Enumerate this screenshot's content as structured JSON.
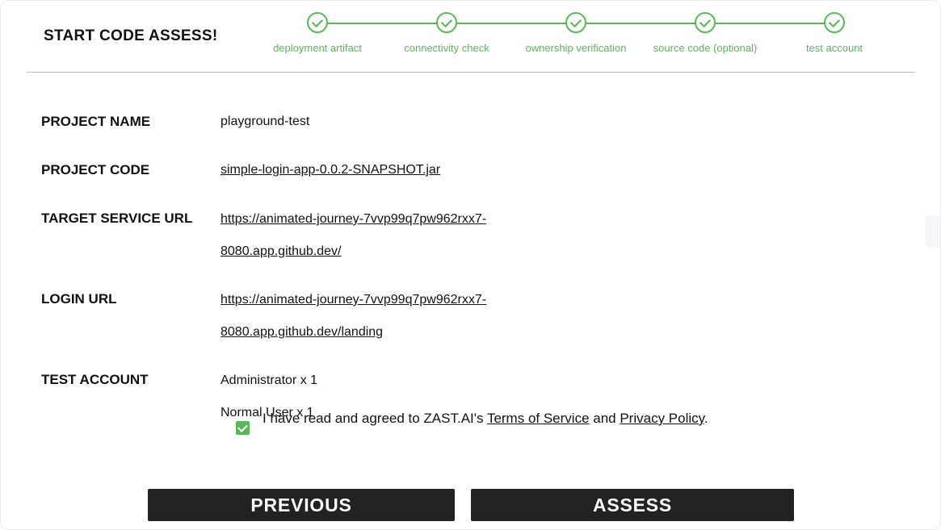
{
  "header": {
    "title": "START CODE ASSESS!"
  },
  "stepper": {
    "color": "#5bb65a",
    "steps": [
      {
        "label": "deployment artifact",
        "completed": true
      },
      {
        "label": "connectivity check",
        "completed": true
      },
      {
        "label": "ownership verification",
        "completed": true
      },
      {
        "label": "source code (optional)",
        "completed": true
      },
      {
        "label": "test account",
        "completed": true
      }
    ]
  },
  "details": {
    "project_name": {
      "label": "PROJECT NAME",
      "value": "playground-test"
    },
    "project_code": {
      "label": "PROJECT CODE",
      "value": "simple-login-app-0.0.2-SNAPSHOT.jar"
    },
    "target_service_url": {
      "label": "TARGET SERVICE URL",
      "value_line1": "https://animated-journey-7vvp99q7pw962rxx7-",
      "value_line2": "8080.app.github.dev/"
    },
    "login_url": {
      "label": "LOGIN URL",
      "value_line1": "https://animated-journey-7vvp99q7pw962rxx7-",
      "value_line2": "8080.app.github.dev/landing"
    },
    "test_account": {
      "label": "TEST ACCOUNT",
      "accounts": [
        "Administrator x 1",
        "Normal User x 1"
      ]
    }
  },
  "agreement": {
    "checked": true,
    "prefix": "I have read and agreed to ZAST.AI's ",
    "terms_label": "Terms of Service",
    "middle": " and ",
    "privacy_label": "Privacy Policy",
    "suffix": "."
  },
  "buttons": {
    "previous_label": "PREVIOUS",
    "assess_label": "ASSESS"
  }
}
